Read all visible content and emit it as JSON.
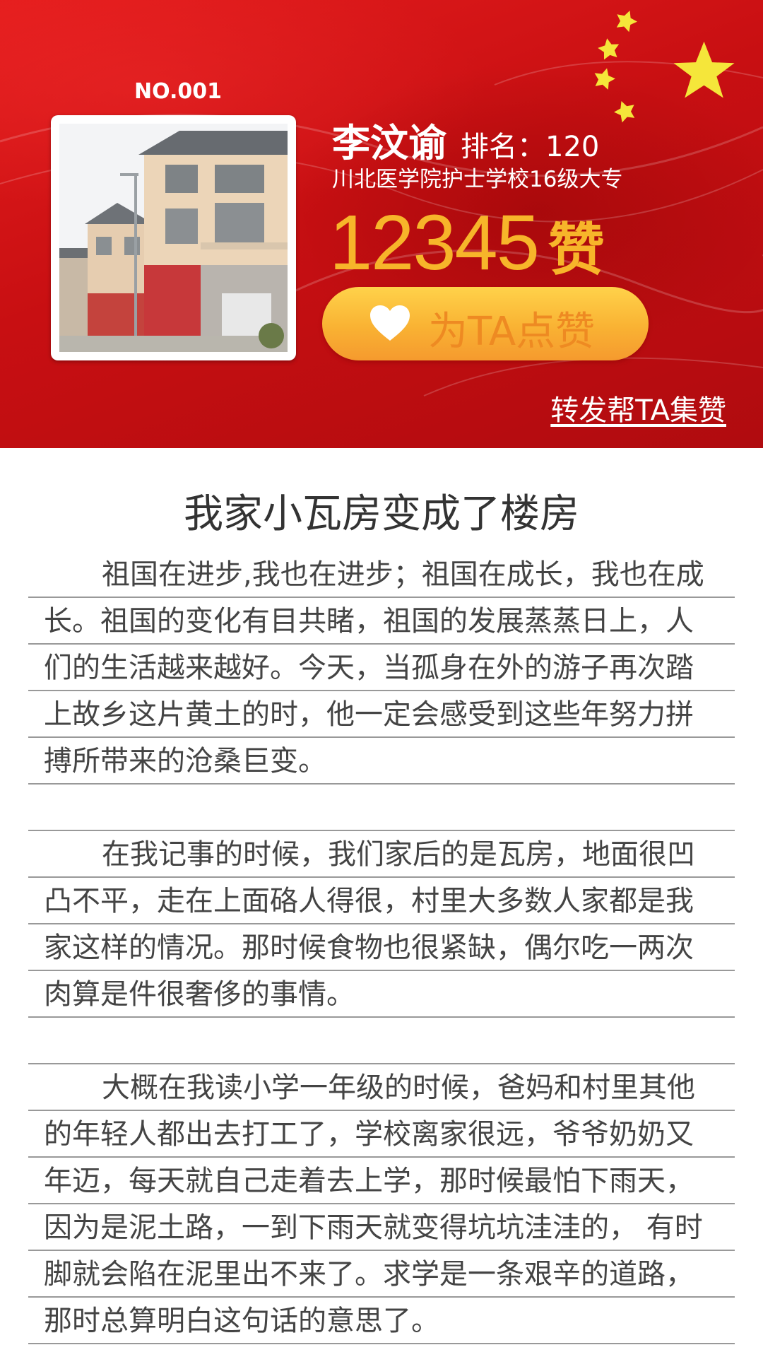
{
  "entry": {
    "number_label": "NO.001",
    "name": "李汶谕",
    "rank_label": "排名：",
    "rank_value": "120",
    "school": "川北医学院护士学校16级大专",
    "likes_count": "12345",
    "likes_unit": "赞",
    "like_button_label": "为TA点赞",
    "share_link": "转发帮TA集赞"
  },
  "colors": {
    "header_red": "#d0141a",
    "gold": "#f7b52a",
    "button_orange": "#f9b233",
    "star_yellow": "#f5e63a"
  },
  "icons": {
    "flag_stars": "stars-decoration-icon",
    "heart": "heart-icon"
  },
  "article": {
    "title": "我家小瓦房变成了楼房",
    "lines": [
      "祖国在进步,我也在进步；祖国在成长，我也在成",
      "长。祖国的变化有目共睹，祖国的发展蒸蒸日上，人",
      "们的生活越来越好。今天，当孤身在外的游子再次踏",
      "上故乡这片黄土的时，他一定会感受到这些年努力拼",
      "搏所带来的沧桑巨变。",
      "",
      "在我记事的时候，我们家后的是瓦房，地面很凹",
      "凸不平，走在上面硌人得很，村里大多数人家都是我",
      "家这样的情况。那时候食物也很紧缺，偶尔吃一两次",
      "肉算是件很奢侈的事情。",
      "",
      "大概在我读小学一年级的时候，爸妈和村里其他",
      "的年轻人都出去打工了，学校离家很远，爷爷奶奶又",
      "年迈，每天就自己走着去上学，那时候最怕下雨天，",
      "因为是泥土路，一到下雨天就变得坑坑洼洼的， 有时",
      "脚就会陷在泥里出不来了。求学是一条艰辛的道路，",
      "那时总算明白这句话的意思了。"
    ]
  }
}
